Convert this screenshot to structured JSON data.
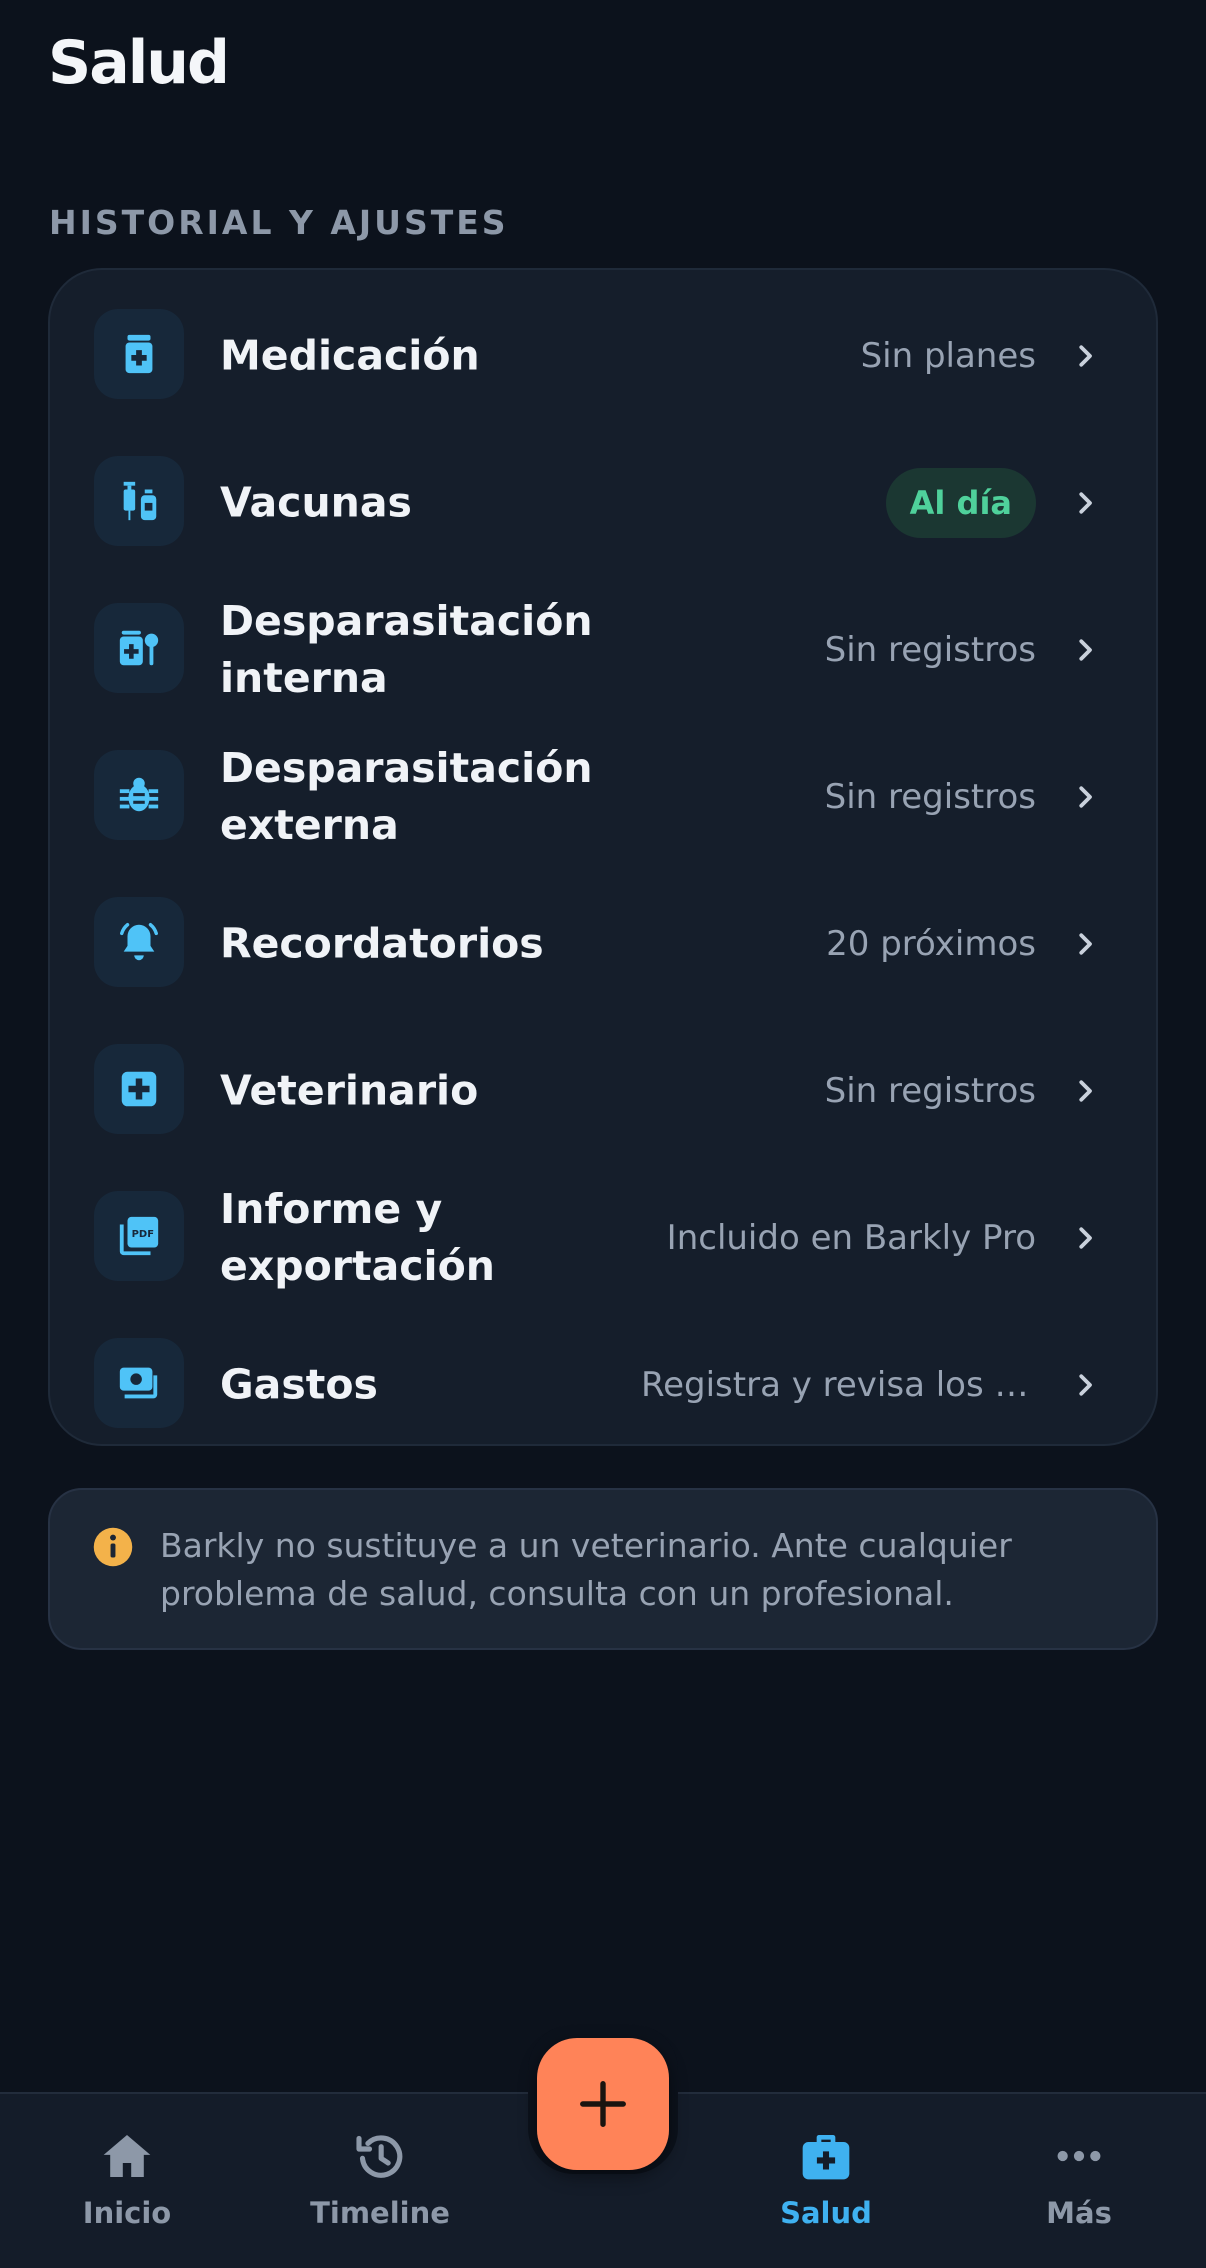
{
  "header": {
    "title": "Salud"
  },
  "section": {
    "label": "HISTORIAL Y AJUSTES"
  },
  "rows": [
    {
      "icon": "medication-bottle-icon",
      "label": "Medicación",
      "value": "Sin planes"
    },
    {
      "icon": "vaccine-syringe-icon",
      "label": "Vacunas",
      "badge": "Al día"
    },
    {
      "icon": "internal-deworming-icon",
      "label": "Desparasitación interna",
      "value": "Sin registros"
    },
    {
      "icon": "bug-icon",
      "label": "Desparasitación externa",
      "value": "Sin registros"
    },
    {
      "icon": "bell-ringing-icon",
      "label": "Recordatorios",
      "value": "20 próximos"
    },
    {
      "icon": "medical-cross-icon",
      "label": "Veterinario",
      "value": "Sin registros"
    },
    {
      "icon": "pdf-export-icon",
      "label": "Informe y exportación",
      "value": "Incluido en Barkly Pro"
    },
    {
      "icon": "money-icon",
      "label": "Gastos",
      "value": "Registra y revisa los gastos"
    }
  ],
  "disclaimer": {
    "icon": "info-icon",
    "text": "Barkly no sustituye a un veterinario. Ante cualquier problema de salud, consulta con un profesional."
  },
  "nav": {
    "items": [
      {
        "icon": "home-icon",
        "label": "Inicio"
      },
      {
        "icon": "history-icon",
        "label": "Timeline"
      },
      {
        "icon": "medkit-icon",
        "label": "Salud",
        "active": true
      },
      {
        "icon": "more-dots-icon",
        "label": "Más"
      }
    ],
    "fab_icon": "plus-icon"
  },
  "colors": {
    "background": "#0c121c",
    "card": "#151e2b",
    "accent": "#3fb1f0",
    "fab": "#ff8358",
    "badge_text": "#4fd19b",
    "badge_bg": "#1b3732",
    "info": "#f3b24a"
  }
}
